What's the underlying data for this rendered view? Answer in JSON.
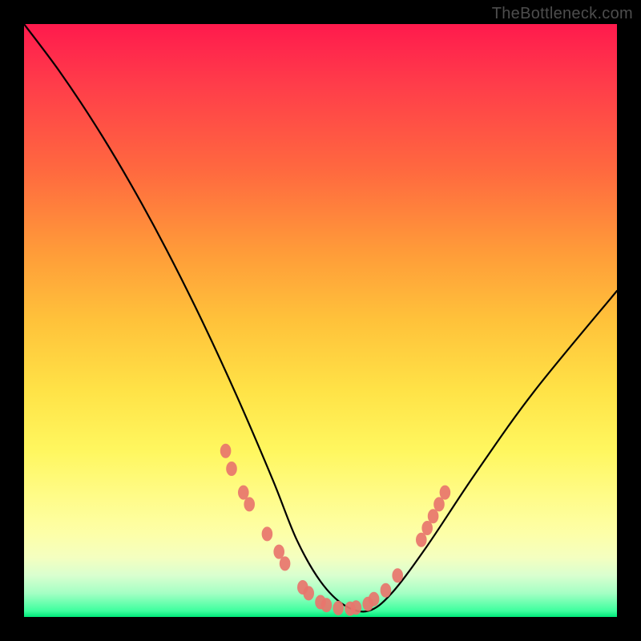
{
  "watermark": {
    "text": "TheBottleneck.com"
  },
  "chart_data": {
    "type": "line",
    "title": "",
    "xlabel": "",
    "ylabel": "",
    "xlim": [
      0,
      100
    ],
    "ylim": [
      0,
      100
    ],
    "grid": false,
    "legend": false,
    "series": [
      {
        "name": "bottleneck-curve",
        "x": [
          0,
          6,
          12,
          18,
          24,
          30,
          36,
          42,
          46,
          50,
          54,
          58,
          62,
          68,
          76,
          86,
          100
        ],
        "y": [
          100,
          92,
          83,
          73,
          62,
          50,
          37,
          23,
          13,
          6,
          2,
          1,
          4,
          12,
          24,
          38,
          55
        ]
      }
    ],
    "markers": [
      {
        "x": 34,
        "y": 28
      },
      {
        "x": 35,
        "y": 25
      },
      {
        "x": 37,
        "y": 21
      },
      {
        "x": 38,
        "y": 19
      },
      {
        "x": 41,
        "y": 14
      },
      {
        "x": 43,
        "y": 11
      },
      {
        "x": 44,
        "y": 9
      },
      {
        "x": 47,
        "y": 5
      },
      {
        "x": 48,
        "y": 4
      },
      {
        "x": 50,
        "y": 2.5
      },
      {
        "x": 51,
        "y": 2
      },
      {
        "x": 53,
        "y": 1.5
      },
      {
        "x": 55,
        "y": 1.4
      },
      {
        "x": 56,
        "y": 1.6
      },
      {
        "x": 58,
        "y": 2.2
      },
      {
        "x": 59,
        "y": 3.0
      },
      {
        "x": 61,
        "y": 4.5
      },
      {
        "x": 63,
        "y": 7
      },
      {
        "x": 67,
        "y": 13
      },
      {
        "x": 68,
        "y": 15
      },
      {
        "x": 69,
        "y": 17
      },
      {
        "x": 70,
        "y": 19
      },
      {
        "x": 71,
        "y": 21
      }
    ],
    "marker_radius": 9,
    "marker_color": "#e8756c",
    "line_color": "#000000",
    "background": "rainbow-vertical"
  }
}
